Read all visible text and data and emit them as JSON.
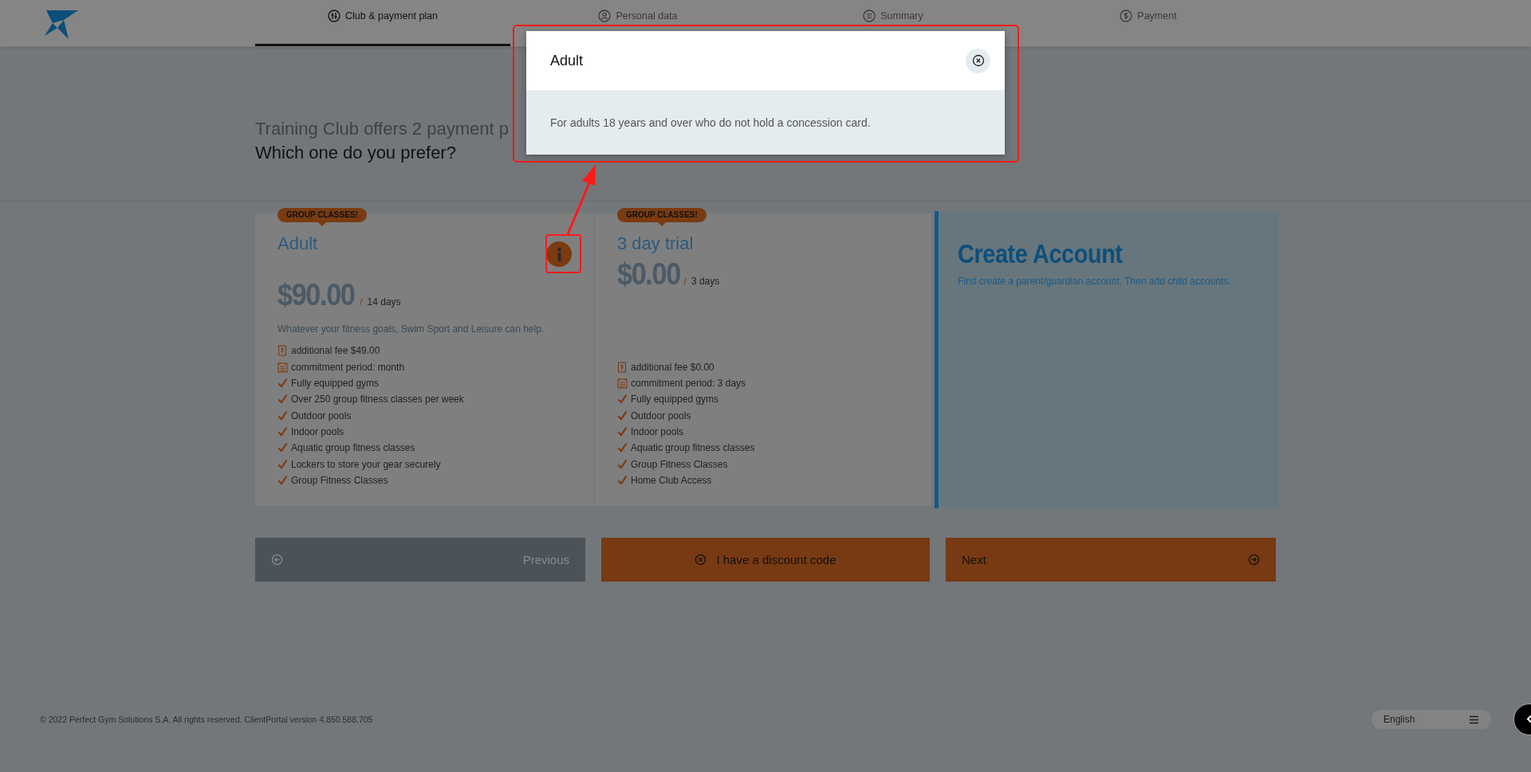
{
  "header": {
    "steps": [
      {
        "label": "Club & payment plan",
        "selected": true
      },
      {
        "label": "Personal data",
        "selected": false
      },
      {
        "label": "Summary",
        "selected": false
      },
      {
        "label": "Payment",
        "selected": false
      }
    ]
  },
  "intro": {
    "line_1": "Training Club offers 2 payment p",
    "line_2": "Which one do you prefer?"
  },
  "plans": [
    {
      "badge": "GROUP CLASSES!",
      "name": "Adult",
      "info_button": true,
      "price": "$90.00",
      "separator": "/",
      "period": "14 days",
      "description": "Whatever your fitness goals, Swim Sport and Leisure can help.",
      "features": [
        {
          "kind": "fee",
          "text": "additional fee $49.00"
        },
        {
          "kind": "commitment",
          "text": "commitment period: month"
        },
        {
          "kind": "check",
          "text": "Fully equipped gyms"
        },
        {
          "kind": "check",
          "text": "Over 250 group fitness classes per week"
        },
        {
          "kind": "check",
          "text": "Outdoor pools"
        },
        {
          "kind": "check",
          "text": "Indoor pools"
        },
        {
          "kind": "check",
          "text": "Aquatic group fitness classes"
        },
        {
          "kind": "check",
          "text": "Lockers to store your gear securely"
        },
        {
          "kind": "check",
          "text": "Group Fitness Classes"
        }
      ]
    },
    {
      "badge": "GROUP CLASSES!",
      "name": "3 day trial",
      "info_button": false,
      "price": "$0.00",
      "separator": "/",
      "period": "3 days",
      "features": [
        {
          "kind": "fee",
          "text": "additional fee $0.00"
        },
        {
          "kind": "commitment",
          "text": "commitment period: 3 days"
        },
        {
          "kind": "check",
          "text": "Fully equipped gyms"
        },
        {
          "kind": "check",
          "text": "Outdoor pools"
        },
        {
          "kind": "check",
          "text": "Indoor pools"
        },
        {
          "kind": "check",
          "text": "Aquatic group fitness classes"
        },
        {
          "kind": "check",
          "text": "Group Fitness Classes"
        },
        {
          "kind": "check",
          "text": "Home Club Access"
        }
      ]
    }
  ],
  "create_account": {
    "title": "Create Account",
    "text": "First create a parent/guardian account. Then add child accounts."
  },
  "buttons": [
    {
      "kind": "previous",
      "label": "Previous"
    },
    {
      "kind": "discount",
      "label": "I have a discount code"
    },
    {
      "kind": "next",
      "label": "Next"
    }
  ],
  "footer": {
    "copyright": "© 2022 Perfect Gym Solutions S.A. All rights reserved. ClientPortal version 4.850.588.705",
    "language": "English"
  },
  "modal": {
    "title": "Adult",
    "text": "For adults 18 years and over who do not hold a concession card."
  }
}
